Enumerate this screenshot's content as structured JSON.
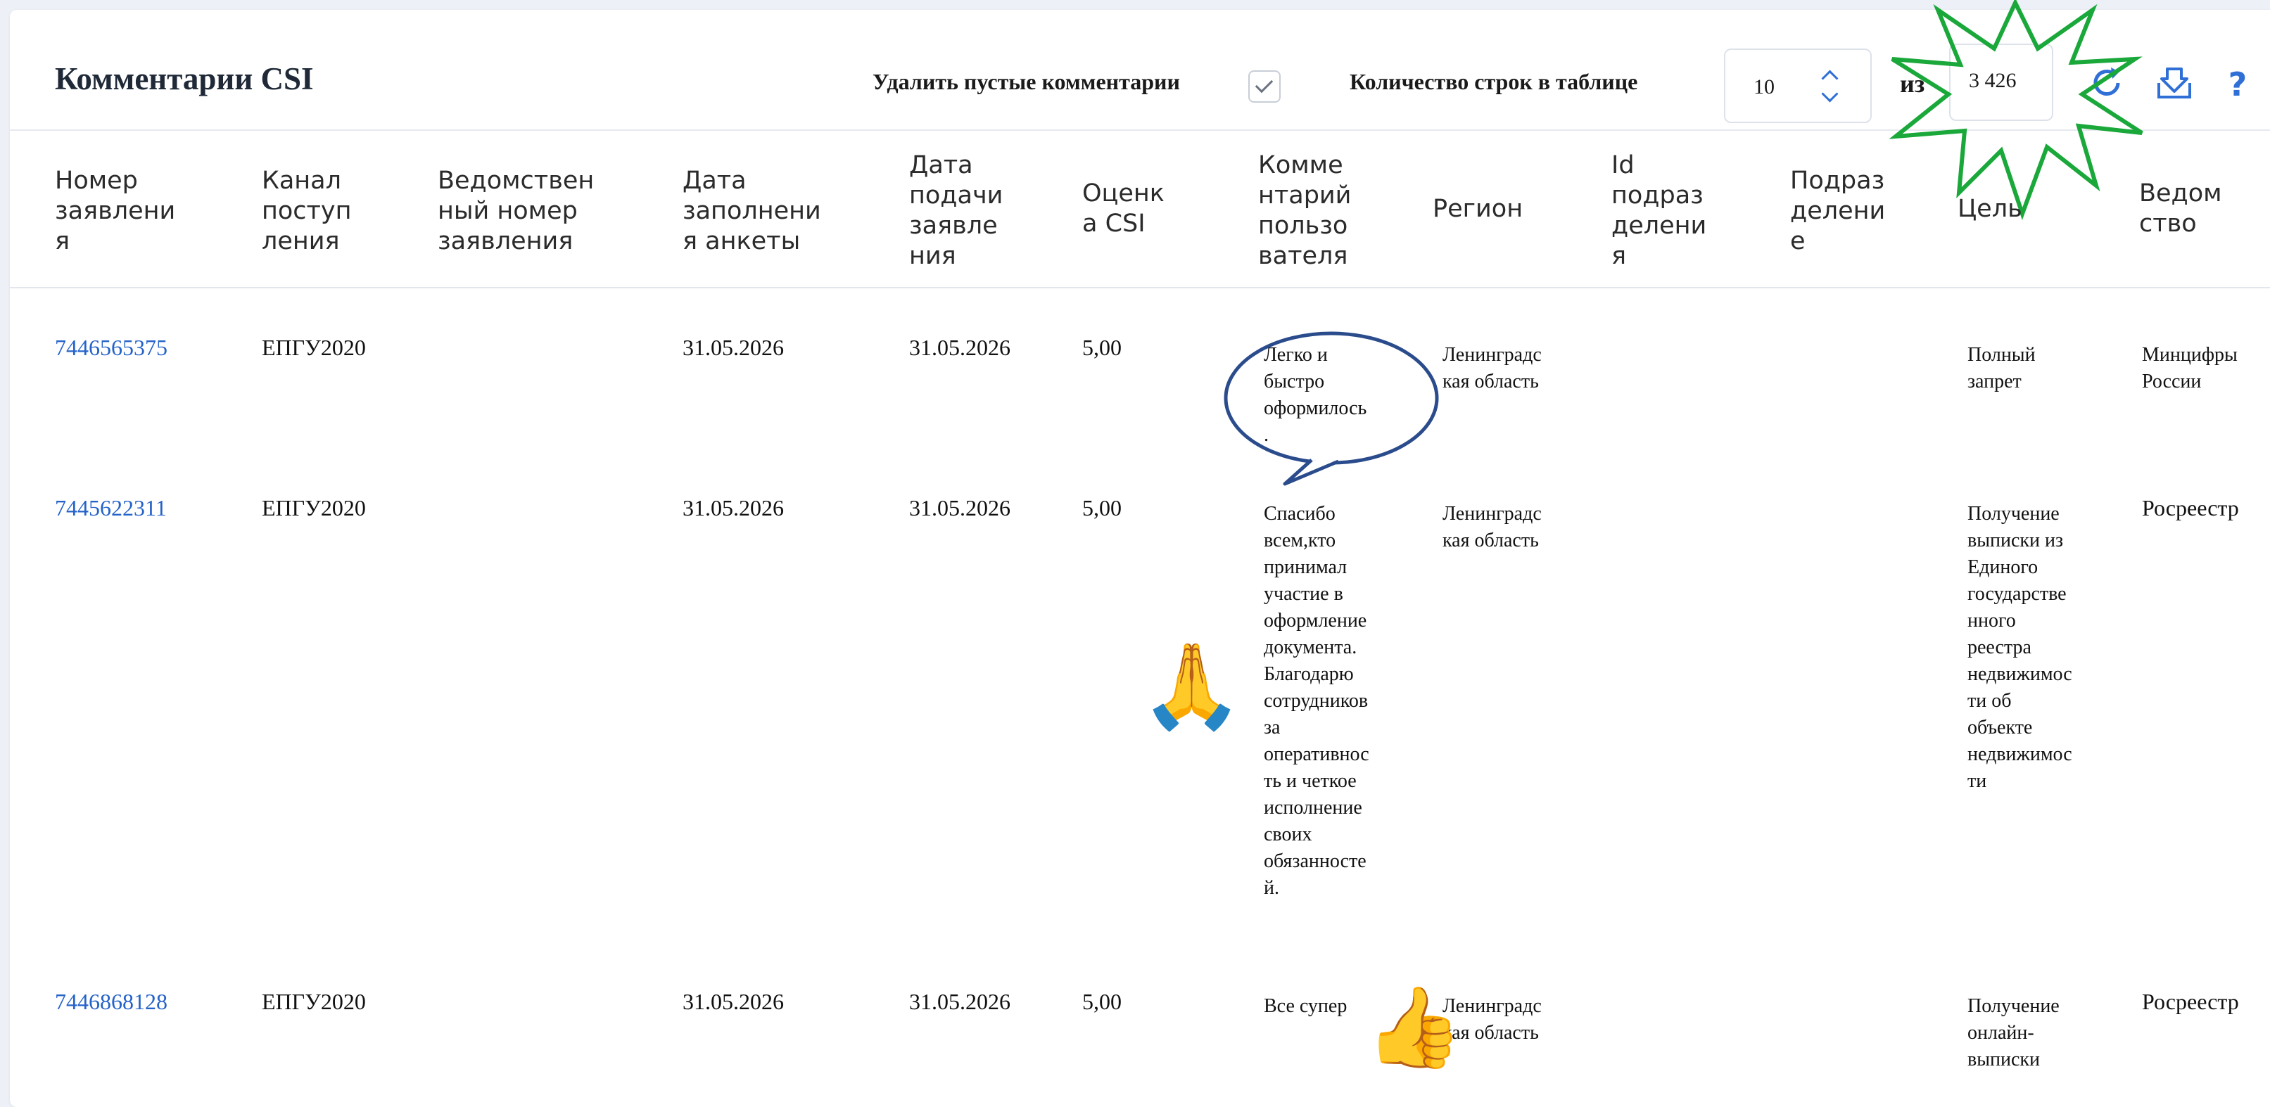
{
  "panel": {
    "title": "Комментарии CSI",
    "delete_empty_label": "Удалить пустые комментарии",
    "delete_empty_checked": true,
    "rows_label": "Количество строк в таблице",
    "rows_value": "10",
    "of_label": "из",
    "total": "3 426"
  },
  "icons": {
    "refresh": "refresh-icon",
    "download": "download-icon",
    "help": "help-icon",
    "help_glyph": "?"
  },
  "columns": [
    "Номер\nзаявлени\nя",
    "Канал\nпоступ\nления",
    "Ведомствен\nный номер\nзаявления",
    "Дата\nзаполнени\nя анкеты",
    "Дата\nподачи\nзаявле\nния",
    "Оценк\nа CSI",
    "Комме\nнтарий\nпользо\nвателя",
    "Регион",
    "Id\nподраз\nделени\nя",
    "Подраз\nделени\nе",
    "Цель",
    "Ведом\nство"
  ],
  "rows": [
    {
      "number": "7446565375",
      "channel": "ЕПГУ2020",
      "dept_number": "",
      "fill_date": "31.05.2026",
      "submit_date": "31.05.2026",
      "csi": "5,00",
      "comment": "Легко и\nбыстро\nоформилось\n.",
      "region": "Ленинградс\nкая область",
      "unit_id": "",
      "unit": "",
      "goal": "Полный\nзапрет",
      "agency": "Минцифры\nРоссии"
    },
    {
      "number": "7445622311",
      "channel": "ЕПГУ2020",
      "dept_number": "",
      "fill_date": "31.05.2026",
      "submit_date": "31.05.2026",
      "csi": "5,00",
      "comment": "Спасибо\nвсем,кто\nпринимал\nучастие в\nоформление\nдокумента.\nБлагодарю\nсотрудников\nза\nоперативнос\nть и четкое\nисполнение\nсвоих\nобязанносте\nй.",
      "region": "Ленинградс\nкая область",
      "unit_id": "",
      "unit": "",
      "goal": "Получение\nвыписки из\nЕдиного\nгосударстве\nнного\nреестра\nнедвижимос\nти об\nобъекте\nнедвижимос\nти",
      "agency": "Росреестр"
    },
    {
      "number": "7446868128",
      "channel": "ЕПГУ2020",
      "dept_number": "",
      "fill_date": "31.05.2026",
      "submit_date": "31.05.2026",
      "csi": "5,00",
      "comment": "Все супер",
      "region": "Ленинградс\nкая область",
      "unit_id": "",
      "unit": "",
      "goal": "Получение\nонлайн-\nвыписки",
      "agency": "Росреестр"
    }
  ],
  "decorations": {
    "accent_green": "#1aa83a",
    "bubble_color": "#2b4c8c",
    "praying_emoji": "🙏",
    "thumbs_emoji": "👍"
  }
}
